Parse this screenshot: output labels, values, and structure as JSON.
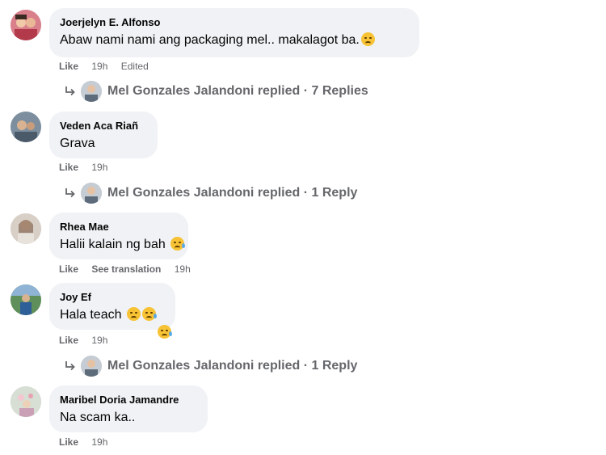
{
  "comments": [
    {
      "author": "Joerjelyn E. Alfonso",
      "text": "Abaw nami nami ang packaging mel.. makalagot ba.",
      "actions": {
        "like": "Like",
        "time": "19h",
        "extra": "Edited"
      },
      "replies": "Mel Gonzales Jalandoni replied · 7 Replies"
    },
    {
      "author": "Veden Aca Riañ",
      "text": "Grava",
      "actions": {
        "like": "Like",
        "time": "19h"
      },
      "replies": "Mel Gonzales Jalandoni replied · 1 Reply"
    },
    {
      "author": "Rhea Mae",
      "text": "Halii kalain ng bah",
      "actions": {
        "like": "Like",
        "translate": "See translation",
        "time": "19h"
      }
    },
    {
      "author": "Joy Ef",
      "text": "Hala teach",
      "actions": {
        "like": "Like",
        "time": "19h"
      },
      "replies": "Mel Gonzales Jalandoni replied · 1 Reply"
    },
    {
      "author": "Maribel Doria Jamandre",
      "text": "Na scam ka..",
      "actions": {
        "like": "Like",
        "time": "19h"
      }
    }
  ],
  "colors": {
    "bubble": "#f0f2f5",
    "meta_text": "#65676b",
    "primary_text": "#050505"
  },
  "icons": [
    "reply-arrow-icon",
    "sad-face-emoji-icon",
    "crying-face-emoji-icon"
  ]
}
